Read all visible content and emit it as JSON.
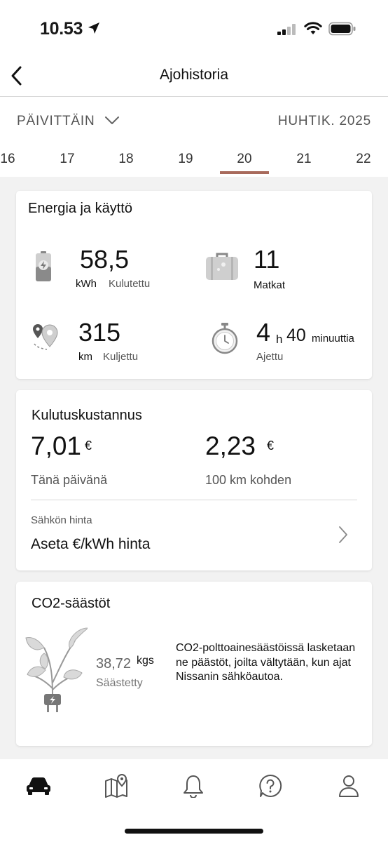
{
  "status": {
    "time": "10.53"
  },
  "header": {
    "title": "Ajohistoria"
  },
  "period": {
    "mode": "PÄIVITTÄIN",
    "month": "HUHTIK. 2025"
  },
  "days": [
    {
      "label": "16",
      "selected": false
    },
    {
      "label": "17",
      "selected": false
    },
    {
      "label": "18",
      "selected": false
    },
    {
      "label": "19",
      "selected": false
    },
    {
      "label": "20",
      "selected": true
    },
    {
      "label": "21",
      "selected": false
    },
    {
      "label": "22",
      "selected": false
    }
  ],
  "energy": {
    "title": "Energia ja käyttö",
    "consumed": {
      "value": "58,5",
      "unit": "kWh",
      "label": "Kulutettu"
    },
    "trips": {
      "value": "11",
      "label": "Matkat"
    },
    "distance": {
      "value": "315",
      "unit": "km",
      "label": "Kuljettu"
    },
    "time": {
      "hours": "4",
      "h_unit": "h",
      "minutes": "40",
      "min_unit": "minuuttia",
      "label": "Ajettu"
    }
  },
  "cost": {
    "title": "Kulutuskustannus",
    "today": {
      "value": "7,01",
      "currency": "€",
      "label": "Tänä päivänä"
    },
    "per100": {
      "value": "2,23",
      "currency": "€",
      "label": "100 km kohden"
    },
    "price_label": "Sähkön hinta",
    "price_action": "Aseta €/kWh hinta"
  },
  "co2": {
    "title": "CO2-säästöt",
    "value": "38,72",
    "unit": "kgs",
    "label": "Säästetty",
    "description": "CO2-polttoainesäästöissä lasketaan ne päästöt, joilta vältytään, kun ajat Nissanin sähköautoa."
  },
  "tabbar": {
    "items": [
      "car-icon",
      "map-icon",
      "bell-icon",
      "help-icon",
      "profile-icon"
    ]
  },
  "colors": {
    "accent": "#a86a5c",
    "background": "#f2f2f2"
  }
}
